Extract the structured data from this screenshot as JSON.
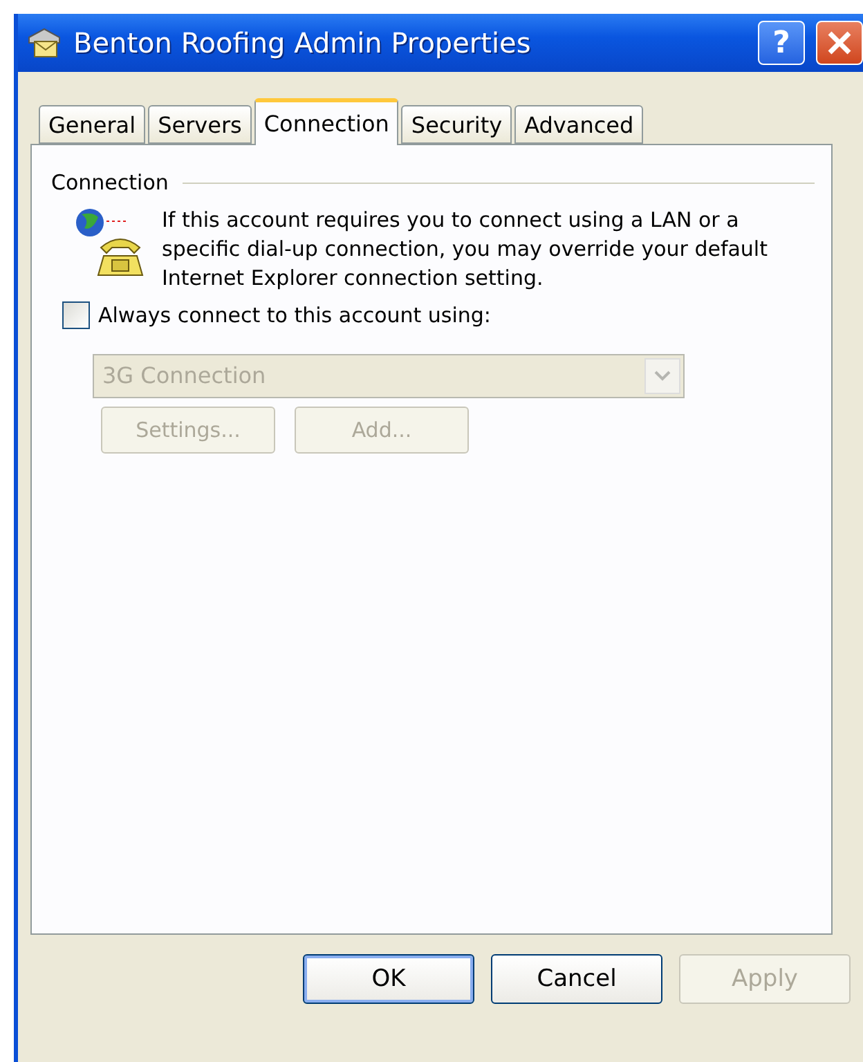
{
  "window": {
    "title": "Benton Roofing Admin Properties",
    "help_button": "?"
  },
  "tabs": [
    {
      "label": "General",
      "selected": false
    },
    {
      "label": "Servers",
      "selected": false
    },
    {
      "label": "Connection",
      "selected": true
    },
    {
      "label": "Security",
      "selected": false
    },
    {
      "label": "Advanced",
      "selected": false
    }
  ],
  "group": {
    "title": "Connection",
    "description": "If this account requires you to connect using a LAN or a specific dial-up connection, you may override your default Internet Explorer connection setting."
  },
  "always_connect": {
    "label": "Always connect to this account using:",
    "checked": false
  },
  "connection_select": {
    "value": "3G Connection",
    "disabled": true
  },
  "connection_buttons": [
    {
      "label": "Settings...",
      "disabled": true
    },
    {
      "label": "Add...",
      "disabled": true
    }
  ],
  "dialog_buttons": [
    {
      "label": "OK",
      "disabled": false,
      "default": true
    },
    {
      "label": "Cancel",
      "disabled": false,
      "default": false
    },
    {
      "label": "Apply",
      "disabled": true,
      "default": false
    }
  ]
}
